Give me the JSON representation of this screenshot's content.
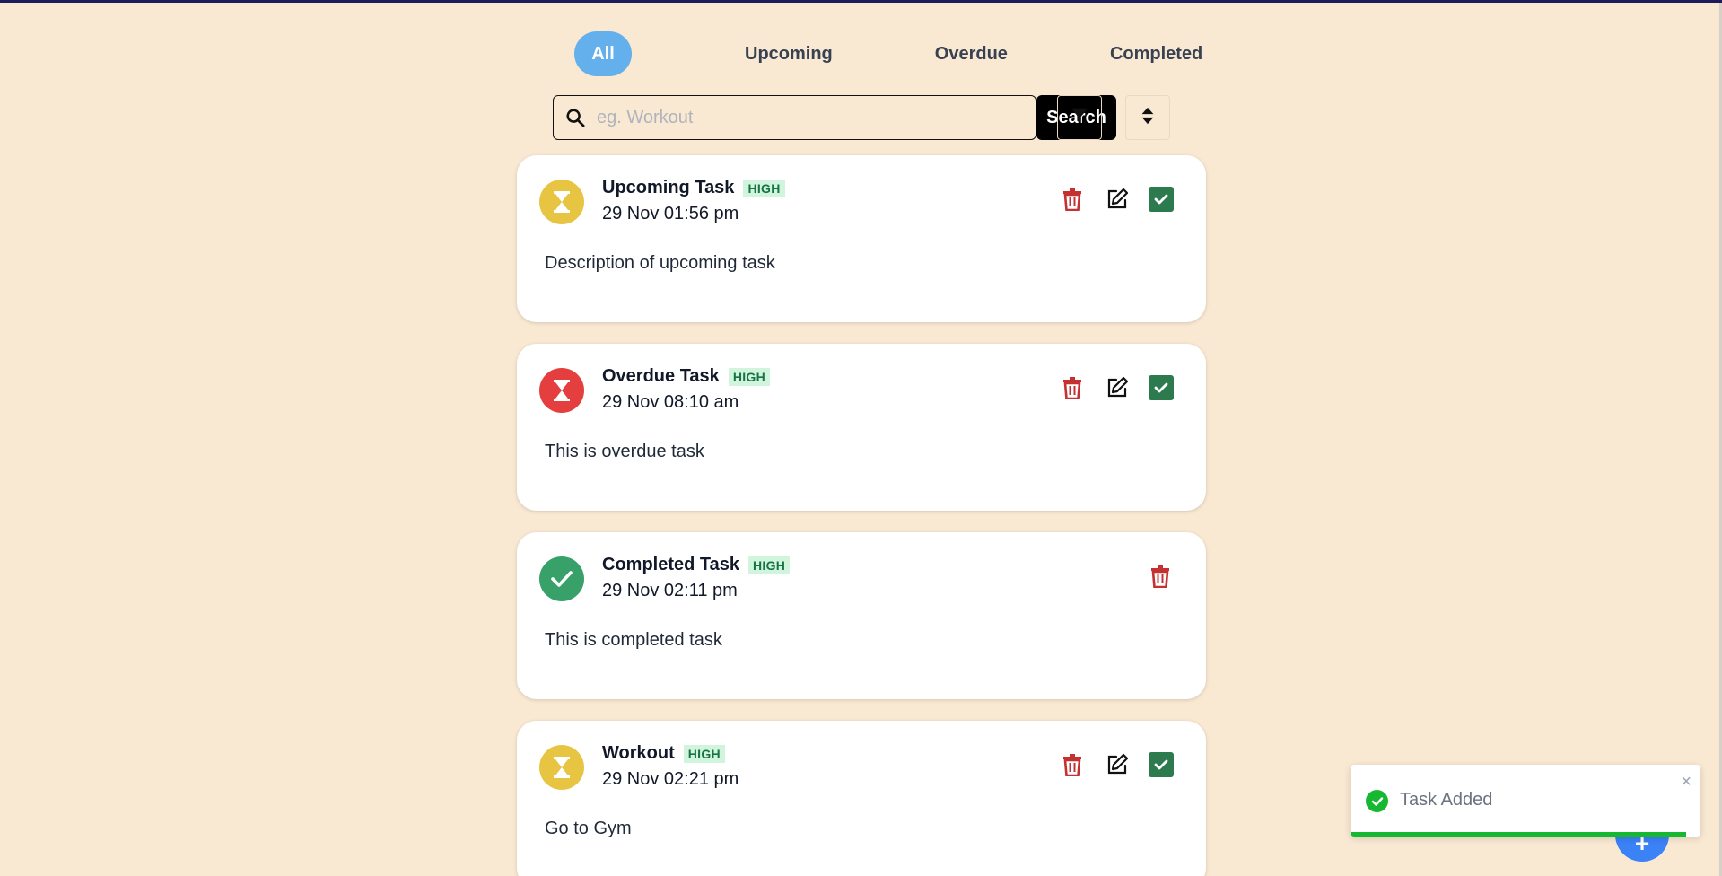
{
  "tabs": [
    {
      "label": "All",
      "active": true
    },
    {
      "label": "Upcoming",
      "active": false
    },
    {
      "label": "Overdue",
      "active": false
    },
    {
      "label": "Completed",
      "active": false
    }
  ],
  "search": {
    "placeholder": "eg. Workout",
    "value": "",
    "button_label": "Search"
  },
  "toolbar": {
    "filter_icon": "filter-icon",
    "sort_icon": "sort-icon"
  },
  "tasks": [
    {
      "title": "Upcoming Task",
      "priority": "HIGH",
      "date": "29 Nov 01:56 pm",
      "description": "Description of upcoming task",
      "status": "upcoming",
      "status_color": "#e8c443"
    },
    {
      "title": "Overdue Task",
      "priority": "HIGH",
      "date": "29 Nov 08:10 am",
      "description": "This is overdue task",
      "status": "overdue",
      "status_color": "#e53e3e"
    },
    {
      "title": "Completed Task",
      "priority": "HIGH",
      "date": "29 Nov 02:11 pm",
      "description": "This is completed task",
      "status": "completed",
      "status_color": "#38a169"
    },
    {
      "title": "Workout",
      "priority": "HIGH",
      "date": "29 Nov 02:21 pm",
      "description": "Go to Gym",
      "status": "upcoming",
      "status_color": "#e8c443"
    }
  ],
  "toast": {
    "message": "Task Added",
    "close": "×",
    "progress": 0.96
  },
  "fab": {
    "label": "+"
  },
  "colors": {
    "background": "#f9e8d2",
    "accent": "#63b0ec",
    "delete": "#c53030",
    "complete": "#2d7a4f"
  }
}
